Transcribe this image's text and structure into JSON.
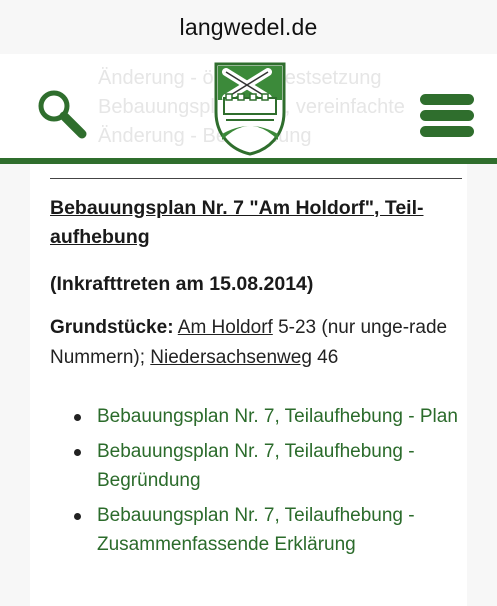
{
  "browser": {
    "url": "langwedel.de"
  },
  "header": {
    "background_text": "Änderung - örtliche Festsetzung Bebauungsplan Nr. 3, vereinfachte Änderung - Begründung"
  },
  "colors": {
    "brand_green": "#2f6e2d",
    "link_green": "#2b6b2b"
  },
  "article": {
    "title": "Bebauungsplan Nr. 7 \"Am Holdorf\", Teil-aufhebung",
    "subtitle": "(Inkrafttreten am 15.08.2014)",
    "plots_label": "Grundstücke:",
    "plots_link1": "Am Holdorf",
    "plots_text1": " 5-23 (nur unge-rade Nummern); ",
    "plots_link2": "Niedersachsenweg",
    "plots_text2": " 46",
    "documents": [
      "Bebauungsplan Nr. 7, Teilaufhebung - Plan",
      "Bebauungsplan Nr. 7, Teilaufhebung - Begründung",
      "Bebauungsplan Nr. 7, Teilaufhebung - Zusammenfassende Erklärung"
    ]
  },
  "icons": {
    "search": "search-icon",
    "menu": "hamburger-menu-icon",
    "logo": "coat-of-arms-logo"
  }
}
